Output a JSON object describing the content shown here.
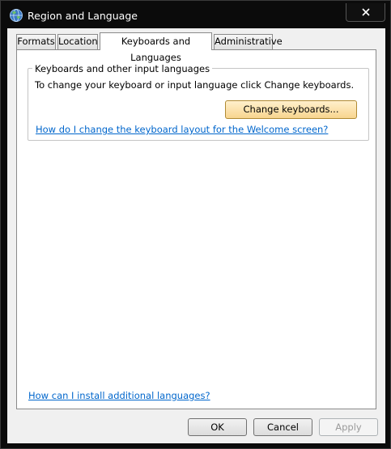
{
  "window": {
    "title": "Region and Language",
    "icon": "globe-icon",
    "close_icon": "close-icon"
  },
  "tabs": [
    {
      "label": "Formats",
      "active": false
    },
    {
      "label": "Location",
      "active": false
    },
    {
      "label": "Keyboards and Languages",
      "active": true
    },
    {
      "label": "Administrative",
      "active": false
    }
  ],
  "keyboards_group": {
    "legend": "Keyboards and other input languages",
    "description": "To change your keyboard or input language click Change keyboards.",
    "change_button": "Change keyboards...",
    "welcome_link": "How do I change the keyboard layout for the Welcome screen?"
  },
  "install_link": "How can I install additional languages?",
  "buttons": {
    "ok": "OK",
    "cancel": "Cancel",
    "apply": "Apply"
  },
  "colors": {
    "link": "#0066cc",
    "highlight_button": "#f8d58f"
  }
}
